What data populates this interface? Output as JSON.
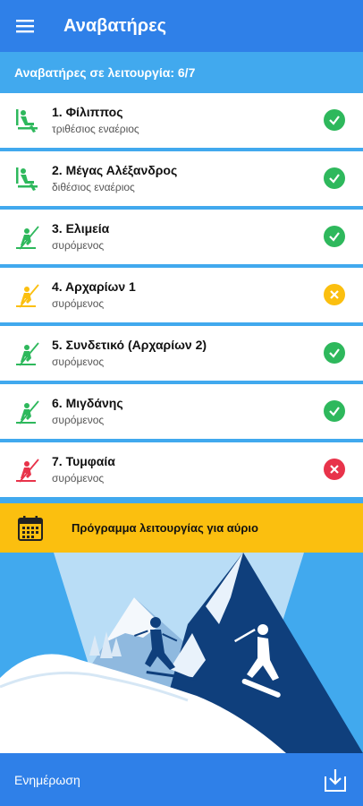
{
  "appbar": {
    "title": "Αναβατήρες",
    "menu_icon": "menu-icon"
  },
  "summary": {
    "text": "Αναβατήρες σε λειτουργία: 6/7"
  },
  "colors": {
    "open": "#2eb85c",
    "limited": "#fbbf0f",
    "closed": "#e8334a"
  },
  "lifts": [
    {
      "name": "1. Φίλιππος",
      "type": "τριθέσιος εναέριος",
      "icon": "chairlift-icon",
      "status": "open"
    },
    {
      "name": "2. Μέγας Αλέξανδρος",
      "type": "διθέσιος εναέριος",
      "icon": "chairlift-icon",
      "status": "open"
    },
    {
      "name": "3. Ελιμεία",
      "type": "συρόμενος",
      "icon": "surface-lift-icon",
      "status": "open"
    },
    {
      "name": "4. Αρχαρίων 1",
      "type": "συρόμενος",
      "icon": "surface-lift-icon",
      "status": "limited"
    },
    {
      "name": "5. Συνδετικό (Αρχαρίων 2)",
      "type": "συρόμενος",
      "icon": "surface-lift-icon",
      "status": "open"
    },
    {
      "name": "6. Μιγδάνης",
      "type": "συρόμενος",
      "icon": "surface-lift-icon",
      "status": "open"
    },
    {
      "name": "7. Τυμφαία",
      "type": "συρόμενος",
      "icon": "surface-lift-icon",
      "status": "closed"
    }
  ],
  "banner": {
    "text": "Πρόγραμμα λειτουργίας για αύριο",
    "icon": "calendar-icon"
  },
  "footer": {
    "text": "Ενημέρωση",
    "icon": "download-icon"
  }
}
